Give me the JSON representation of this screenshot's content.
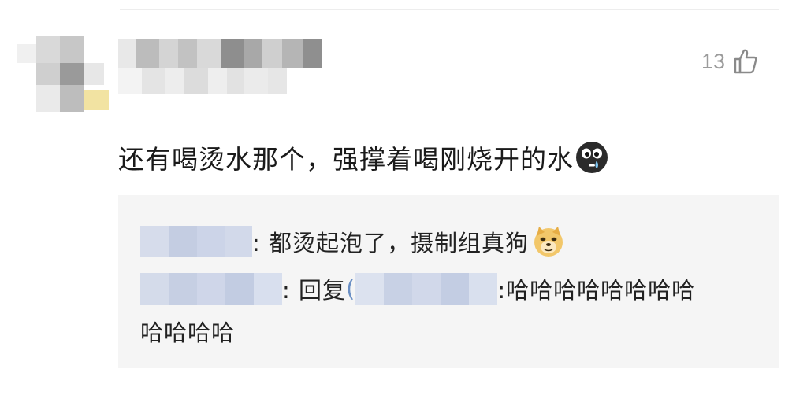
{
  "comment": {
    "like_count": "13",
    "text": "还有喝烫水那个，强撑着喝刚烧开的水",
    "text_emoji": "crying-face-icon"
  },
  "replies": [
    {
      "text": ": 都烫起泡了，摄制组真狗",
      "emoji": "doge-icon"
    },
    {
      "prefix": ": 回复",
      "at_symbol": "(",
      "body_line1": ":哈哈哈哈哈哈哈哈",
      "body_line2": "哈哈哈哈"
    }
  ],
  "colors": {
    "reply_bg": "#f5f5f5",
    "blurred_name": "#c9d3e8",
    "like_gray": "#9b9b9b"
  }
}
